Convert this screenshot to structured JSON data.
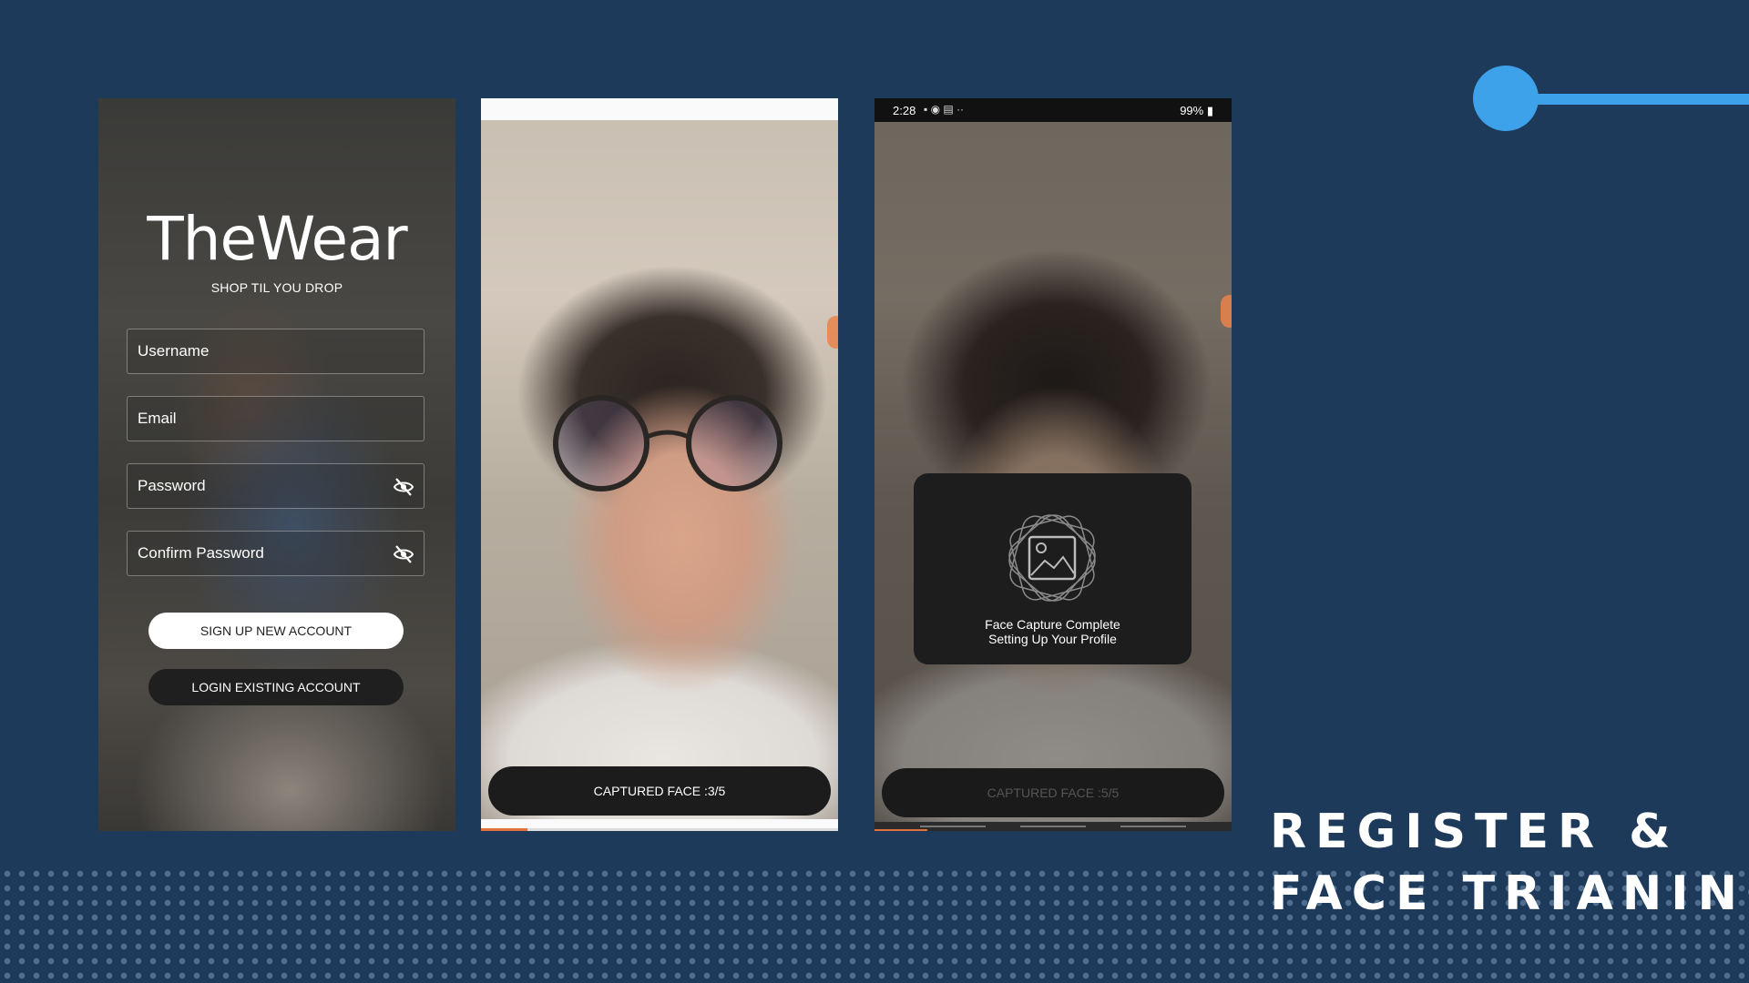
{
  "slide": {
    "title_line1": "REGISTER &",
    "title_line2": "FACE TRIANING"
  },
  "colors": {
    "background": "#1e3a5a",
    "accent": "#3ea2ea"
  },
  "register_screen": {
    "brand": "TheWear",
    "tagline": "SHOP TIL YOU DROP",
    "fields": {
      "username": "Username",
      "email": "Email",
      "password": "Password",
      "confirm_password": "Confirm Password"
    },
    "icons": {
      "password_toggle": "eye-off-icon",
      "confirm_toggle": "eye-off-icon"
    },
    "signup_button": "SIGN UP NEW ACCOUNT",
    "login_button": "LOGIN EXISTING ACCOUNT"
  },
  "capture_screen": {
    "status": "CAPTURED FACE :3/5",
    "captured": 3,
    "total": 5
  },
  "complete_screen": {
    "statusbar": {
      "time": "2:28",
      "battery": "99%"
    },
    "dialog_line1": "Face Capture Complete",
    "dialog_line2": "Setting Up Your Profile",
    "status": "CAPTURED FACE :5/5",
    "captured": 5,
    "total": 5
  }
}
